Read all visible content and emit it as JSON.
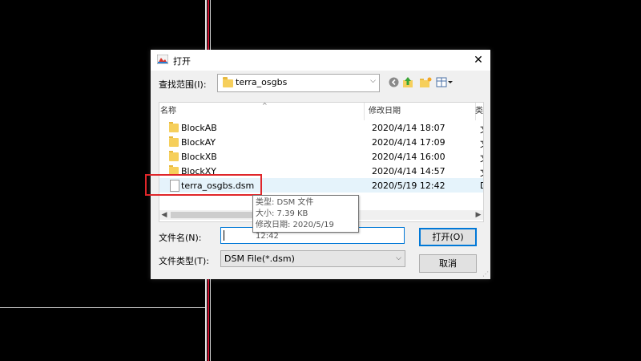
{
  "dialog": {
    "title": "打开",
    "look_in_label": "查找范围(I):",
    "look_in_value": "terra_osgbs",
    "columns": {
      "name": "名称",
      "date": "修改日期",
      "type": "类型"
    },
    "files": [
      {
        "name": "BlockAB",
        "date": "2020/4/14 18:07",
        "type": "文件夹",
        "kind": "folder"
      },
      {
        "name": "BlockAY",
        "date": "2020/4/14 17:09",
        "type": "文件夹",
        "kind": "folder"
      },
      {
        "name": "BlockXB",
        "date": "2020/4/14 16:00",
        "type": "文件夹",
        "kind": "folder"
      },
      {
        "name": "BlockXY",
        "date": "2020/4/14 14:57",
        "type": "文件夹",
        "kind": "folder"
      },
      {
        "name": "terra_osgbs.dsm",
        "date": "2020/5/19 12:42",
        "type": "DSM",
        "kind": "file"
      }
    ],
    "tooltip": {
      "type": "类型: DSM 文件",
      "size": "大小: 7.39 KB",
      "modified": "修改日期: 2020/5/19 12:42"
    },
    "filename_label": "文件名(N):",
    "filename_value": "",
    "filetype_label": "文件类型(T):",
    "filetype_value": "DSM File(*.dsm)",
    "open_button": "打开(O)",
    "cancel_button": "取消",
    "close_glyph": "✕"
  },
  "colors": {
    "highlight": "#e0262a",
    "focus": "#0078d7",
    "folder": "#f6cf5b",
    "background": "#000000"
  }
}
